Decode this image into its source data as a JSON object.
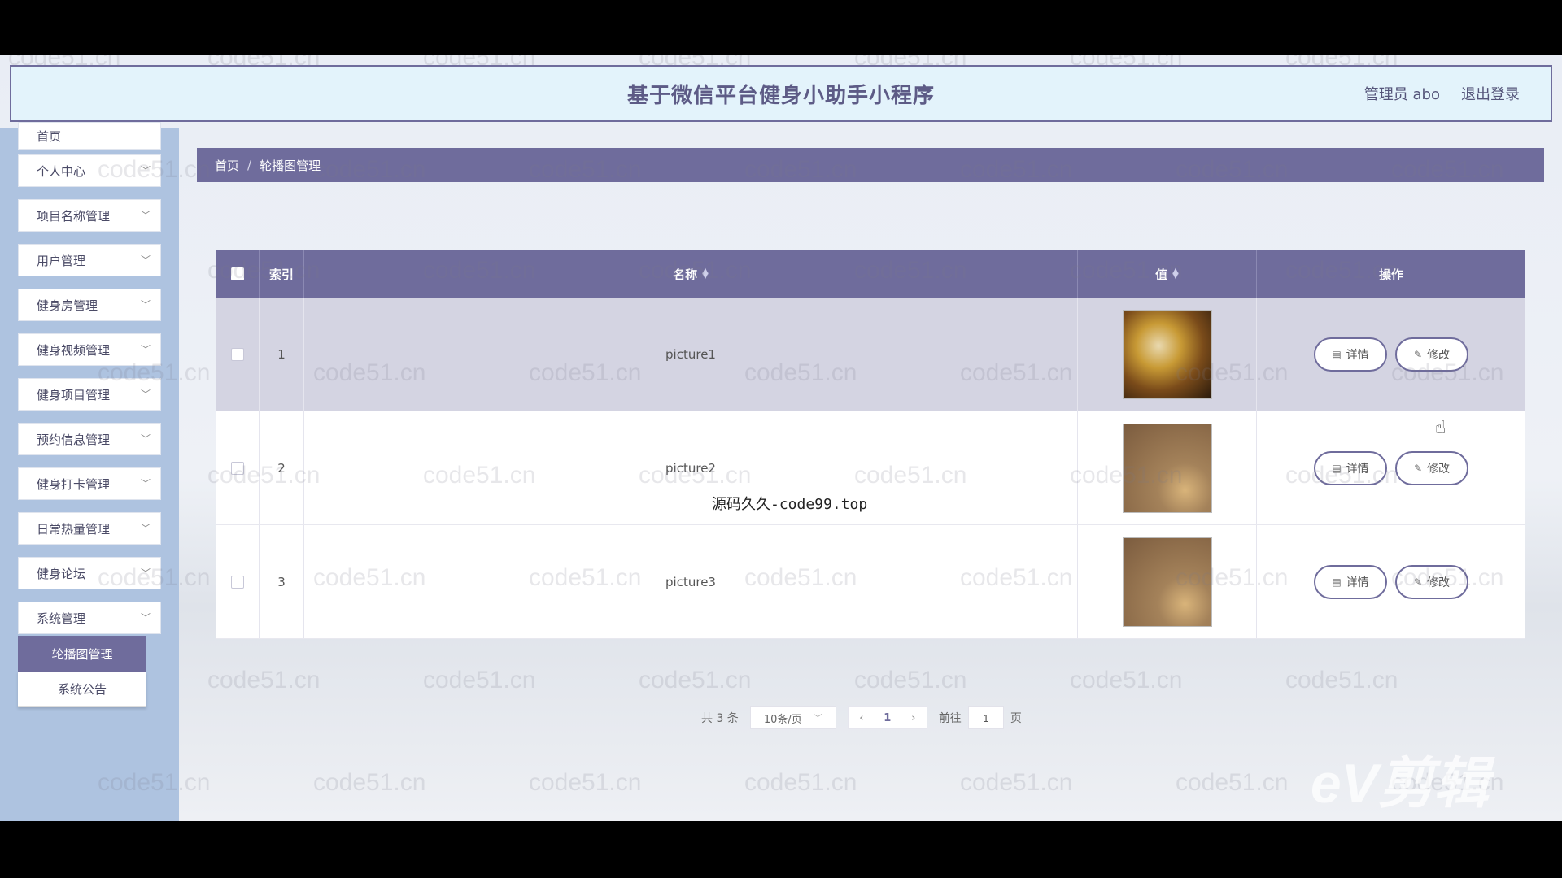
{
  "header": {
    "title": "基于微信平台健身小助手小程序",
    "user": "管理员 abo",
    "logout": "退出登录"
  },
  "sidebar": {
    "items": [
      {
        "label": "首页"
      },
      {
        "label": "个人中心"
      },
      {
        "label": "项目名称管理"
      },
      {
        "label": "用户管理"
      },
      {
        "label": "健身房管理"
      },
      {
        "label": "健身视频管理"
      },
      {
        "label": "健身项目管理"
      },
      {
        "label": "预约信息管理"
      },
      {
        "label": "健身打卡管理"
      },
      {
        "label": "日常热量管理"
      },
      {
        "label": "健身论坛"
      },
      {
        "label": "系统管理"
      }
    ],
    "submenu": [
      {
        "label": "轮播图管理"
      },
      {
        "label": "系统公告"
      }
    ]
  },
  "breadcrumb": {
    "home": "首页",
    "sep": "/",
    "current": "轮播图管理"
  },
  "table": {
    "columns": [
      "索引",
      "名称",
      "值",
      "操作"
    ],
    "rows": [
      {
        "index": "1",
        "name": "picture1",
        "detail": "详情",
        "edit": "修改"
      },
      {
        "index": "2",
        "name": "picture2",
        "detail": "详情",
        "edit": "修改"
      },
      {
        "index": "3",
        "name": "picture3",
        "detail": "详情",
        "edit": "修改"
      }
    ]
  },
  "pager": {
    "total": "共 3 条",
    "size": "10条/页",
    "current": "1",
    "goto_label": "前往",
    "goto_value": "1",
    "page_unit": "页"
  },
  "overlay": {
    "text": "源码久久-code99.top"
  },
  "watermark": {
    "text": "code51.cn",
    "brand": "eV剪辑"
  },
  "colors": {
    "accent": "#6f6c9c",
    "sidebar": "#aec3e0",
    "header_bg": "#e3f3fb"
  }
}
